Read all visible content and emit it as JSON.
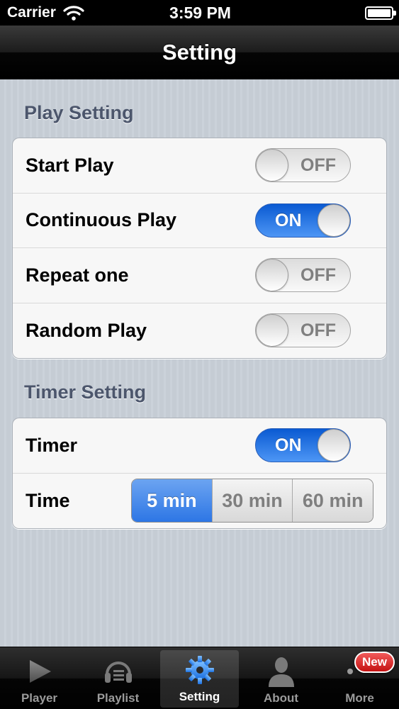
{
  "status_bar": {
    "carrier": "Carrier",
    "time": "3:59 PM"
  },
  "nav": {
    "title": "Setting"
  },
  "play_section": {
    "header": "Play Setting",
    "rows": [
      {
        "label": "Start Play",
        "toggle": "OFF"
      },
      {
        "label": "Continuous Play",
        "toggle": "ON"
      },
      {
        "label": "Repeat one",
        "toggle": "OFF"
      },
      {
        "label": "Random Play",
        "toggle": "OFF"
      }
    ]
  },
  "timer_section": {
    "header": "Timer Setting",
    "timer": {
      "label": "Timer",
      "toggle": "ON"
    },
    "time": {
      "label": "Time",
      "options": [
        "5 min",
        "30 min",
        "60 min"
      ],
      "selected": "5 min"
    }
  },
  "tab_bar": {
    "tabs": [
      {
        "label": "Player",
        "icon": "play-icon"
      },
      {
        "label": "Playlist",
        "icon": "playlist-icon"
      },
      {
        "label": "Setting",
        "icon": "gear-icon",
        "active": true
      },
      {
        "label": "About",
        "icon": "person-icon"
      },
      {
        "label": "More",
        "icon": "more-icon",
        "badge": "New"
      }
    ]
  },
  "colors": {
    "accent_blue": "#2d76e5",
    "toggle_on": "#1e6fe0",
    "badge_red": "#d11a1a",
    "section_header": "#4c566c"
  }
}
